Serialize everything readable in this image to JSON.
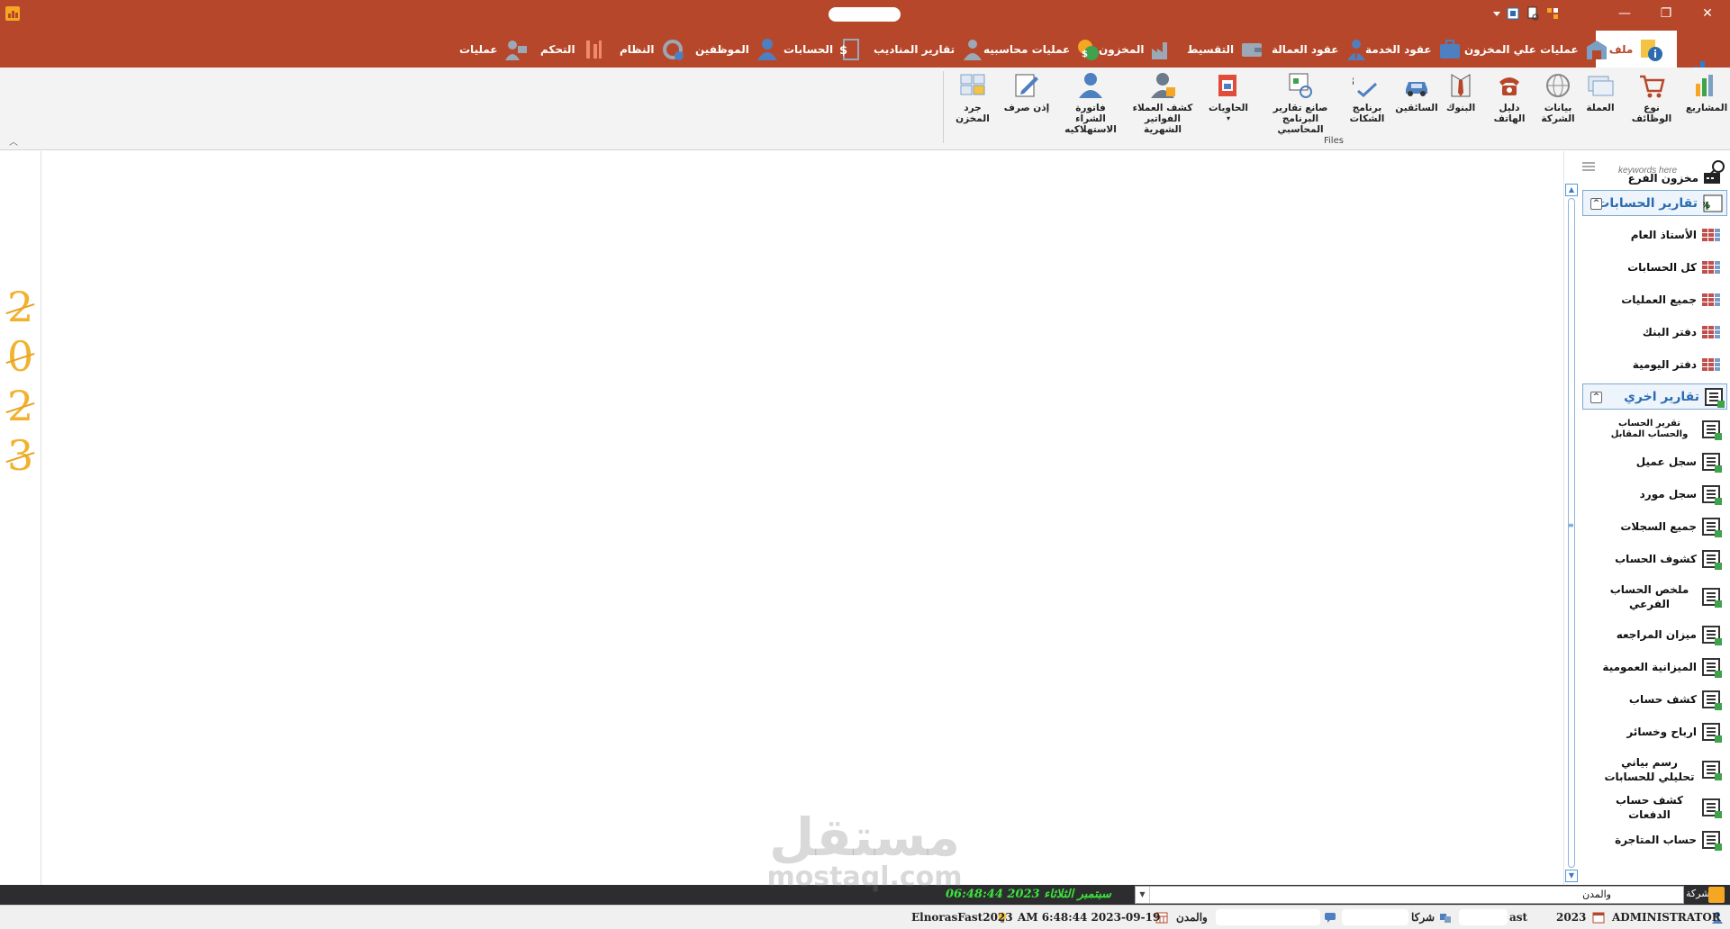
{
  "colors": {
    "brand": "#b7472a",
    "accent_blue": "#2b6cb0",
    "year_gold": "#f1b22e",
    "status_green": "#39e639"
  },
  "tabs": [
    {
      "label": "ملف",
      "icon": "file-info-icon",
      "active": true
    },
    {
      "label": "عمليات علي المخزون",
      "icon": "warehouse-icon"
    },
    {
      "label": "عقود الخدمة",
      "icon": "briefcase-icon"
    },
    {
      "label": "عقود العمالة",
      "icon": "worker-icon"
    },
    {
      "label": "التقسيط",
      "icon": "wallet-icon"
    },
    {
      "label": "المخزون",
      "icon": "factory-icon"
    },
    {
      "label": "عمليات محاسبيه",
      "icon": "coins-icon"
    },
    {
      "label": "تقارير المناديب",
      "icon": "agent-icon"
    },
    {
      "label": "الحسابات",
      "icon": "dollar-icon"
    },
    {
      "label": "الموظفين",
      "icon": "employee-icon"
    },
    {
      "label": "النظام",
      "icon": "system-refresh-icon"
    },
    {
      "label": "التحكم",
      "icon": "controls-icon"
    },
    {
      "label": "عمليات",
      "icon": "operations-icon"
    }
  ],
  "ribbon": {
    "group_label": "Files",
    "buttons": [
      {
        "label": "المشاريع",
        "icon": "projects-icon"
      },
      {
        "label": "نوع الوظائف",
        "icon": "cart-icon"
      },
      {
        "label": "العملة",
        "icon": "currency-icon"
      },
      {
        "label": "بيانات الشركة",
        "icon": "globe-icon"
      },
      {
        "label": "دليل الهاتف",
        "icon": "phone-icon"
      },
      {
        "label": "البنوك",
        "icon": "bank-tie-icon"
      },
      {
        "label": "السائقين",
        "icon": "car-icon"
      },
      {
        "label": "برنامج الشكات",
        "icon": "spellcheck-icon"
      },
      {
        "label": "صانع تقارير البرنامج المحاسبي",
        "icon": "report-maker-icon"
      },
      {
        "label": "الحاويات",
        "icon": "containers-icon"
      },
      {
        "label": "كشف العملاء الفواتير الشهرية",
        "icon": "customer-statement-icon"
      },
      {
        "label": "فاتورة الشراء الاستهلاكيه",
        "icon": "user-invoice-icon"
      },
      {
        "label": "إذن صرف",
        "icon": "edit-icon"
      },
      {
        "label": "جرد المخزن",
        "icon": "inventory-icon"
      }
    ]
  },
  "year_digits": [
    "2",
    "0",
    "2",
    "3"
  ],
  "nav": {
    "search_placeholder": "keywords here",
    "top_item": "مخزون الفرع",
    "groups": [
      {
        "title": "تقارير الحسابات",
        "items": [
          "الأستاذ العام",
          "كل الحسابات",
          "جميع العمليات",
          "دفتر البنك",
          "دفتر اليومية"
        ]
      },
      {
        "title": "تقارير اخري",
        "items": [
          "تقرير الحساب والحساب المقابل",
          "سجل عميل",
          "سجل مورد",
          "جميع السجلات",
          "كشوف الحساب",
          "ملخص الحساب الفرعي",
          "ميزان المراجعه",
          "الميزانية العمومية",
          "كشف حساب",
          "ارباح وخسائر",
          "رسم بياني تحليلي للحسابات",
          "كشف حساب الدفعات",
          "حساب المتاجرة"
        ]
      }
    ]
  },
  "status": {
    "datetime_banner": "سبتمبر الثلاثاء 2023 06:48:44",
    "combo_value": "والمدن",
    "company_label": "شركة",
    "user": "ADMINISTRATOR",
    "year": "2023",
    "company_short": "شركا",
    "fragment_ast": "ast",
    "cities_label": "والمدن",
    "datetime": "AM 6:48:44 2023-09-19",
    "app_name": "ElnorasFast2023"
  },
  "watermark": {
    "arabic": "مستقل",
    "latin": "mostaql.com"
  },
  "window": {
    "minimize": "—",
    "restore": "❐",
    "close": "✕"
  }
}
